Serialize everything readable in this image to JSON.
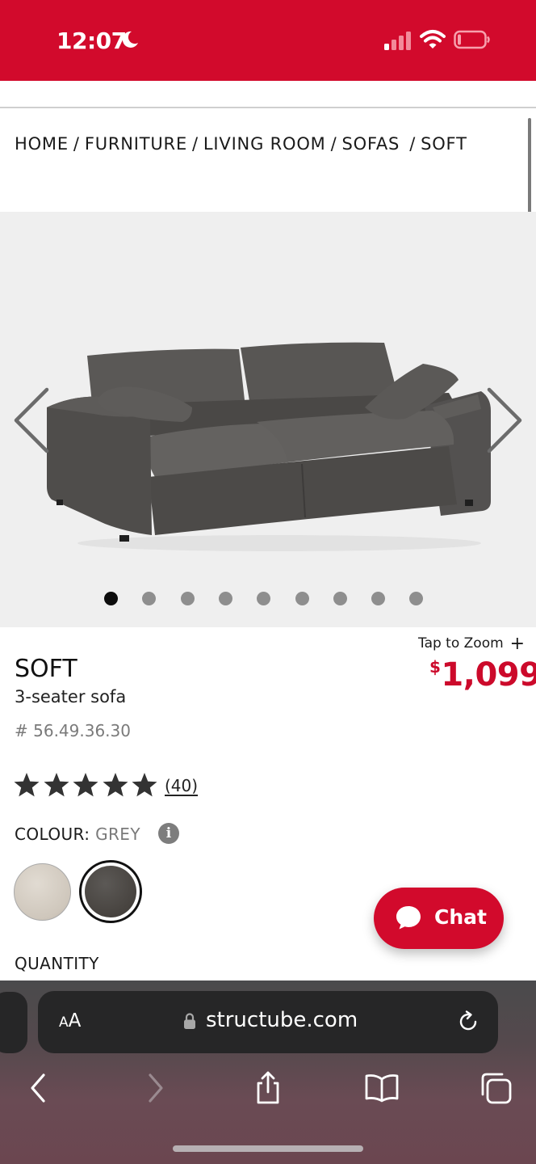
{
  "status_bar": {
    "time": "12:07",
    "background_color": "#d20a2c",
    "icons": [
      "moon-icon",
      "cellular-signal-icon",
      "wifi-icon",
      "battery-icon"
    ]
  },
  "breadcrumb": [
    "HOME",
    "FURNITURE",
    "LIVING ROOM",
    "SOFAS",
    "SOFT"
  ],
  "gallery": {
    "image": "grey-sofa-image",
    "prev_icon": "chevron-left-icon",
    "next_icon": "chevron-right-icon",
    "total_images": 9,
    "active_index": 0
  },
  "product": {
    "zoom_label": "Tap to Zoom",
    "zoom_icon": "plus-icon",
    "price_currency": "$",
    "price_value": "1,099",
    "price_color": "#cc0a2b",
    "name": "SOFT",
    "subtitle": "3-seater sofa",
    "sku": "# 56.49.36.30",
    "rating": 5,
    "review_count": "(40)",
    "colour_label": "COLOUR: ",
    "colour_value": "GREY",
    "info_icon": "info-icon",
    "info_glyph": "i",
    "swatches": [
      {
        "name": "beige",
        "color": "#cfc7bc",
        "selected": false
      },
      {
        "name": "grey",
        "color": "#47433f",
        "selected": true
      }
    ],
    "quantity_label": "QUANTITY"
  },
  "chat": {
    "label": "Chat",
    "icon": "chat-bubble-icon",
    "color": "#d20a2c"
  },
  "browser": {
    "text_size_button": "AA",
    "url": "structube.com",
    "icons": [
      "lock-icon",
      "reload-icon",
      "back-icon",
      "forward-icon",
      "share-icon",
      "bookmarks-icon",
      "tabs-icon"
    ]
  }
}
